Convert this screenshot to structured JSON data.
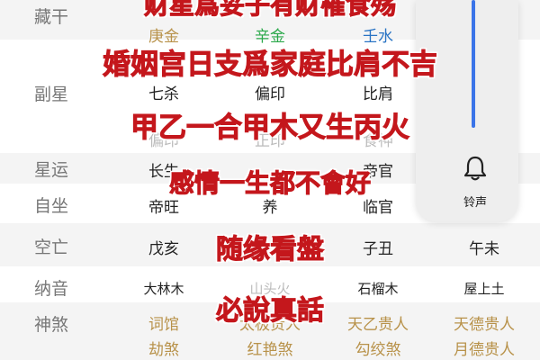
{
  "rows": {
    "canggan": {
      "label": "藏干",
      "cells": [
        "庚金",
        "辛金",
        "壬水"
      ]
    },
    "fuxing": {
      "label": "副星",
      "cells": [
        "七杀",
        "偏印",
        "比肩"
      ],
      "partial": [
        "偏印",
        "正印",
        "食神"
      ]
    },
    "xingyun": {
      "label": "星运",
      "cells": [
        "长生",
        "",
        "帝官"
      ]
    },
    "zizuo": {
      "label": "自坐",
      "cells": [
        "帝旺",
        "养",
        "临官"
      ]
    },
    "kongwang": {
      "label": "空亡",
      "cells": [
        "戊亥",
        "",
        "子丑",
        "午未"
      ]
    },
    "nayin": {
      "label": "纳音",
      "cells": [
        "大林木",
        "山头火",
        "石榴木",
        "屋上土"
      ]
    },
    "shensha": {
      "label": "神煞",
      "col1": [
        "词馆",
        "劫煞"
      ],
      "col2": [
        "太极贵人",
        "红艳煞"
      ],
      "col3": [
        "天乙贵人",
        "勾绞煞"
      ],
      "col4": [
        "天德贵人",
        "月德贵人"
      ]
    }
  },
  "overlays": {
    "line1": "财星爲妥子有财罹食殇",
    "line2": "婚姻宫日支爲家庭比肩不吉",
    "line3": "甲乙一合甲木又生丙火",
    "line4": "感情一生都不會好",
    "line5": "随缘看盤",
    "line6": "必說真話"
  },
  "panel": {
    "bell_label": "铃声",
    "level": 0.58
  },
  "colors": {
    "accent": "#3a74e8",
    "overlay_red": "#c4171c",
    "gold": "#b8924a"
  }
}
